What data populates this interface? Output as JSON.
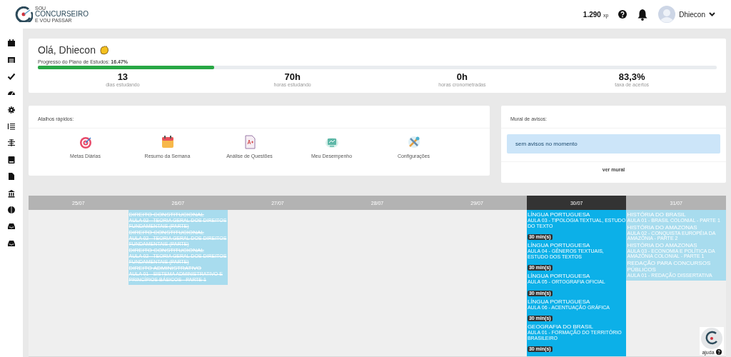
{
  "header": {
    "logo_top": "SOU",
    "logo_main": "CONCURSEIRO",
    "logo_bottom": "E VOU PASSAR",
    "xp": "1.290",
    "xp_unit": "xp",
    "user": "Dhiecon"
  },
  "greeting": {
    "title": "Olá, Dhiecon",
    "progress_label": "Progresso do Plano de Estudos:",
    "progress_value": "16.47%",
    "level": 0.26,
    "stats": [
      {
        "value": "13",
        "label": "dias estudando"
      },
      {
        "value": "70h",
        "label": "horas estudando"
      },
      {
        "value": "0h",
        "label": "horas cronometradas"
      },
      {
        "value": "83,3%",
        "label": "taxa de acertos"
      }
    ]
  },
  "shortcuts": {
    "title": "Atalhos rápidos:",
    "items": [
      {
        "label": "Metas Diárias"
      },
      {
        "label": "Resumo da Semana"
      },
      {
        "label": "Análise de Questões"
      },
      {
        "label": "Meu Desempenho"
      },
      {
        "label": "Configurações"
      }
    ]
  },
  "notices": {
    "title": "Mural de avisos:",
    "message": "sem avisos no momento",
    "link": "ver mural"
  },
  "calendar": {
    "days": [
      {
        "date": "25/07",
        "selected": false
      },
      {
        "date": "26/07",
        "selected": false,
        "items": [
          {
            "subject": "DIREITO CONSTITUCIONAL",
            "lesson": "AULA 02 - TEORIA GERAL DOS DIREITOS FUNDAMENTAIS (PARTE)",
            "done": true
          },
          {
            "subject": "DIREITO CONSTITUCIONAL",
            "lesson": "AULA 02 - TEORIA GERAL DOS DIREITOS FUNDAMENTAIS (PARTE)",
            "done": true
          },
          {
            "subject": "DIREITO CONSTITUCIONAL",
            "lesson": "AULA 02 - TEORIA GERAL DOS DIREITOS FUNDAMENTAIS (PARTE)",
            "done": true
          },
          {
            "subject": "DIREITO ADMINISTRATIVO",
            "lesson": "AULA 01 - SISTEMA ADMINISTRATIVO E PRINCÍPIOS BÁSICOS - PARTE 1",
            "done": true
          }
        ]
      },
      {
        "date": "27/07",
        "selected": false
      },
      {
        "date": "28/07",
        "selected": false
      },
      {
        "date": "29/07",
        "selected": false
      },
      {
        "date": "30/07",
        "selected": true,
        "items": [
          {
            "subject": "LÍNGUA PORTUGUESA",
            "lesson": "AULA 03 - TIPOLOGIA TEXTUAL, ESTUDO DO TEXTO",
            "duration": "30 min(s)",
            "done": false
          },
          {
            "subject": "LÍNGUA PORTUGUESA",
            "lesson": "AULA 04 - GÊNEROS TEXTUAIS, ESTUDO DOS TEXTOS",
            "duration": "30 min(s)",
            "done": false
          },
          {
            "subject": "LÍNGUA PORTUGUESA",
            "lesson": "AULA 05 - ORTOGRAFIA OFICIAL",
            "duration": "30 min(s)",
            "done": false
          },
          {
            "subject": "LÍNGUA PORTUGUESA",
            "lesson": "AULA 06 - ACENTUAÇÃO GRÁFICA",
            "duration": "30 min(s)",
            "done": false
          },
          {
            "subject": "GEOGRAFIA DO BRASIL",
            "lesson": "AULA 01 - FORMAÇÃO DO TERRITÓRIO BRASILEIRO",
            "duration": "30 min(s)",
            "done": false
          }
        ]
      },
      {
        "date": "31/07",
        "selected": false,
        "items": [
          {
            "subject": "HISTÓRIA DO BRASIL",
            "lesson": "AULA 01 - BRASIL COLONIAL - PARTE 1",
            "done": false
          },
          {
            "subject": "HISTÓRIA DO AMAZONAS",
            "lesson": "AULA 02 - CONQUISTA EUROPÉIA DA AMAZÔNIA - PARTE 2",
            "done": false
          },
          {
            "subject": "HISTÓRIA DO AMAZONAS",
            "lesson": "AULA 03 - ECONOMIA E POLÍTICA DA AMAZÔNIA COLONIAL - PARTE 1",
            "done": false
          },
          {
            "subject": "REDAÇÃO PARA CONCURSOS PÚBLICOS",
            "lesson": "AULA 01 - REDAÇÃO DISSERTATIVA",
            "done": false
          }
        ]
      }
    ]
  },
  "help": {
    "label": "ajuda"
  }
}
